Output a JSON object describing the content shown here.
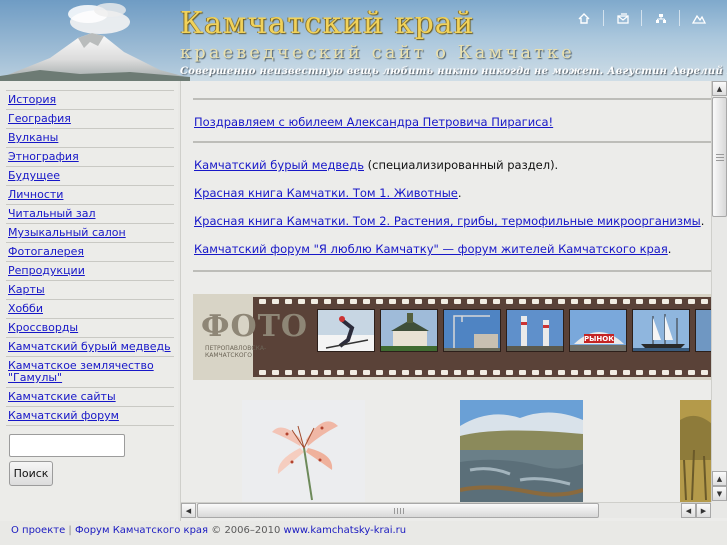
{
  "header": {
    "title": "Камчатский край",
    "subtitle": "краеведческий сайт о Камчатке",
    "quote": "Совершенно неизвестную вещь любить никто никогда не может. Августин Аврелий Блаженный",
    "icons": [
      "home-icon",
      "mail-icon",
      "sitemap-icon",
      "mountains-icon"
    ]
  },
  "sidebar": {
    "items": [
      {
        "label": "История"
      },
      {
        "label": "География"
      },
      {
        "label": "Вулканы"
      },
      {
        "label": "Этнография"
      },
      {
        "label": "Будущее"
      },
      {
        "label": "Личности"
      },
      {
        "label": "Читальный зал"
      },
      {
        "label": "Музыкальный салон"
      },
      {
        "label": "Фотогалерея"
      },
      {
        "label": "Репродукции"
      },
      {
        "label": "Карты"
      },
      {
        "label": "Хобби"
      },
      {
        "label": "Кроссворды"
      },
      {
        "label": "Камчатский бурый медведь"
      },
      {
        "label": "Камчатское землячество \"Гамулы\""
      },
      {
        "label": "Камчатские сайты"
      },
      {
        "label": "Камчатский форум"
      }
    ],
    "search": {
      "value": "",
      "placeholder": "",
      "button_label": "Поиск"
    }
  },
  "main": {
    "announcement": "Поздравляем с юбилеем Александра Петровича Пирагиса!",
    "links": [
      {
        "link": "Камчатский бурый медведь",
        "suffix": " (специализированный раздел)."
      },
      {
        "link": "Красная книга Камчатки. Том 1. Животные",
        "suffix": "."
      },
      {
        "link": "Красная книга Камчатки. Том 2. Растения, грибы, термофильные микроорганизмы",
        "suffix": "."
      },
      {
        "link": "Камчатский форум \"Я люблю Камчатку\" — форум жителей Камчатского края",
        "suffix": "."
      }
    ],
    "filmstrip": {
      "label": "ФОТО",
      "sublabel": "Петропавловска-Камчатского",
      "badge": "РЫНОК"
    }
  },
  "footer": {
    "about": "О проекте",
    "separator": "|",
    "forum": "Форум Камчатского края",
    "copyright": "© 2006–2010",
    "url": "www.kamchatsky-krai.ru"
  },
  "colors": {
    "link": "#1717c8",
    "title_gold": "#f1d25a",
    "film_brown": "#5a4238",
    "background": "#e9e9e6"
  }
}
